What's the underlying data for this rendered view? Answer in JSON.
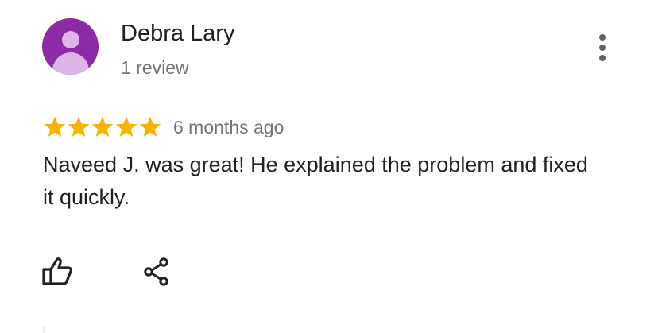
{
  "reviewer": {
    "name": "Debra Lary",
    "review_count": "1 review",
    "avatar_color": "#8d2aa6",
    "avatar_icon": "person-placeholder-icon"
  },
  "review": {
    "rating": 5,
    "max_rating": 5,
    "star_color": "#f5b400",
    "date": "6 months ago",
    "text": "Naveed J. was great! He explained the problem and fixed it quickly."
  },
  "actions": {
    "more_icon": "more-vert-icon",
    "like_icon": "thumb-up-icon",
    "share_icon": "share-icon"
  }
}
